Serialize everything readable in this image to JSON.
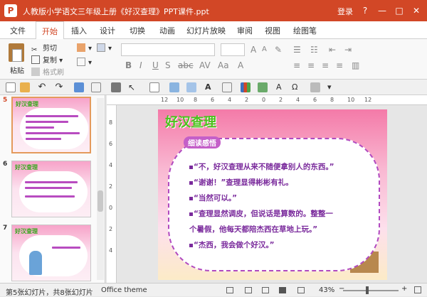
{
  "window": {
    "title": "人教版小学语文三年级上册《好汉查理》PPT课件.ppt",
    "login": "登录",
    "app_icon": "P"
  },
  "tabs": [
    "文件",
    "开始",
    "插入",
    "设计",
    "切换",
    "动画",
    "幻灯片放映",
    "审阅",
    "视图",
    "绘图笔"
  ],
  "active_tab": "开始",
  "ribbon": {
    "paste": "粘贴",
    "cut": "剪切",
    "copy": "复制",
    "format_painter": "格式刷"
  },
  "ruler": {
    "top": [
      "12",
      "10",
      "8",
      "6",
      "4",
      "2",
      "0",
      "2",
      "4",
      "6",
      "8",
      "10",
      "12"
    ],
    "left": [
      "8",
      "6",
      "4",
      "2",
      "0",
      "2",
      "4"
    ]
  },
  "thumbnails": [
    {
      "number": "5",
      "title": "好汉查理",
      "selected": true
    },
    {
      "number": "6",
      "title": "好汉查理",
      "selected": false
    },
    {
      "number": "7",
      "title": "好汉查理",
      "selected": false
    }
  ],
  "slide": {
    "title": "好汉查理",
    "subtitle": "细读感悟",
    "lines": [
      "“不，好汉查理从来不随便拿别人的东西。”",
      "“谢谢！”查理显得彬彬有礼。",
      "“当然可以。”",
      "“查理显然调皮，但说话是算数的。整整一",
      "个暑假，他每天都陪杰西在草地上玩。”",
      "“杰西，我会做个好汉。”"
    ]
  },
  "status": {
    "slide_info": "第5张幻灯片，共8张幻灯片",
    "theme": "Office theme",
    "zoom": "43%"
  }
}
